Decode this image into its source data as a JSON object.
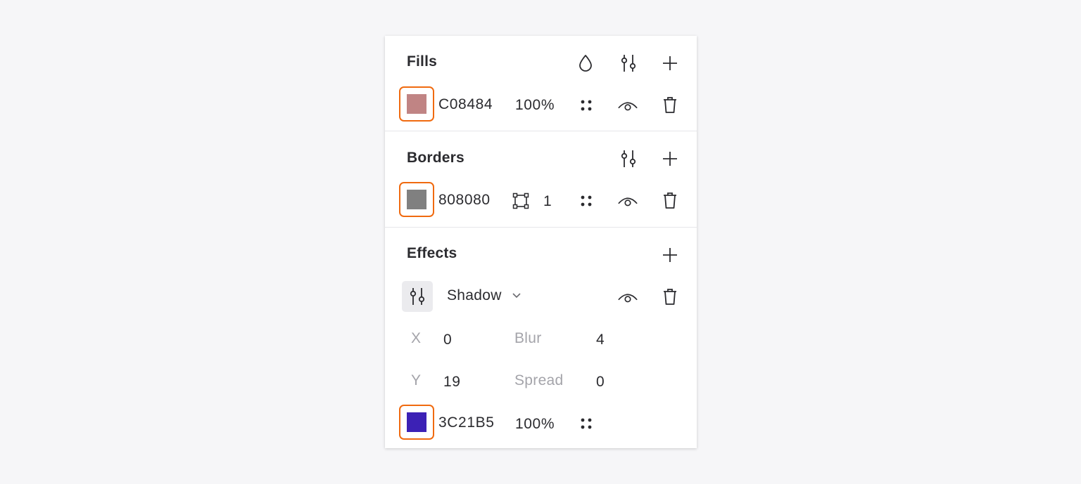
{
  "fills": {
    "title": "Fills",
    "color_hex": "C08484",
    "swatch_color": "#C08484",
    "opacity": "100%"
  },
  "borders": {
    "title": "Borders",
    "color_hex": "808080",
    "swatch_color": "#808080",
    "width": "1"
  },
  "effects": {
    "title": "Effects",
    "effect_type": "Shadow",
    "x_label": "X",
    "x_value": "0",
    "y_label": "Y",
    "y_value": "19",
    "blur_label": "Blur",
    "blur_value": "4",
    "spread_label": "Spread",
    "spread_value": "0",
    "color_hex": "3C21B5",
    "swatch_color": "#3C21B5",
    "opacity": "100%"
  },
  "colors": {
    "highlight_border": "#F06A0F",
    "panel_background": "#FFFFFF",
    "page_background": "#F6F6F8"
  },
  "icons": [
    "drop-icon",
    "sliders-icon",
    "plus-icon",
    "grid-dots-icon",
    "eye-icon",
    "trash-icon",
    "border-frame-icon",
    "chevron-down-icon"
  ]
}
